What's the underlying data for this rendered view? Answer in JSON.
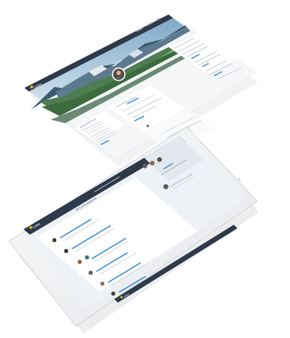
{
  "colors": {
    "topbar": "#2e3a4c",
    "accent": "#f0b400",
    "link": "#3a8fd6",
    "card": "#ffffff",
    "panel_bg": "#eef2f6",
    "tablet_body": "#f2f3f5",
    "text_line": "#b9c2cc"
  },
  "logo_a": {
    "text": "Lobbe"
  },
  "logo_b": {
    "text": "Lobbe"
  },
  "logo_c": {
    "text": "Lobbe"
  },
  "section": {
    "title": "All Conversations"
  },
  "icons": {
    "logo": "leaf-logo-icon",
    "avatar": "user-avatar-icon",
    "home": "home-button-icon",
    "camera": "front-camera-icon"
  }
}
